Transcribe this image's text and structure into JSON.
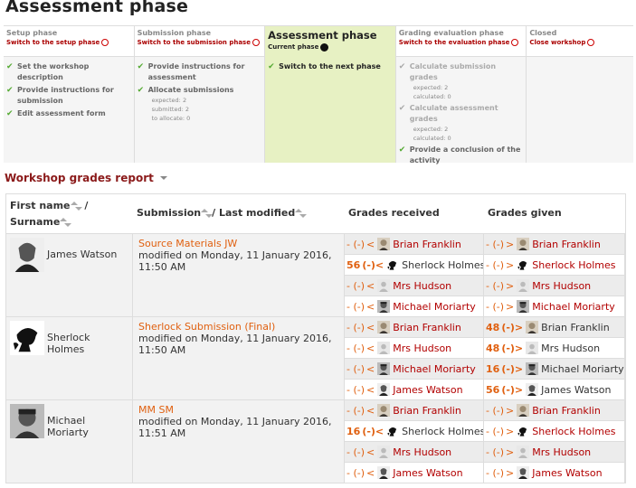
{
  "page_title": "Assessment phase",
  "phases": [
    {
      "name": "Setup phase",
      "action": "Switch to the setup phase",
      "tasks": [
        {
          "label": "Set the workshop description",
          "done": true
        },
        {
          "label": "Provide instructions for submission",
          "done": true
        },
        {
          "label": "Edit assessment form",
          "done": true
        }
      ]
    },
    {
      "name": "Submission phase",
      "action": "Switch to the submission phase",
      "tasks": [
        {
          "label": "Provide instructions for assessment",
          "done": true
        },
        {
          "label": "Allocate submissions",
          "done": true,
          "details": [
            "expected: 2",
            "submitted: 2",
            "to allocate: 0"
          ]
        }
      ]
    },
    {
      "name": "Assessment phase",
      "action": "Current phase",
      "tasks": [
        {
          "label": "Switch to the next phase",
          "done": true
        }
      ]
    },
    {
      "name": "Grading evaluation phase",
      "action": "Switch to the evaluation phase",
      "tasks": [
        {
          "label": "Calculate submission grades",
          "done": false,
          "details": [
            "expected: 2",
            "calculated: 0"
          ]
        },
        {
          "label": "Calculate assessment grades",
          "done": false,
          "details": [
            "expected: 2",
            "calculated: 0"
          ]
        },
        {
          "label": "Provide a conclusion of the activity",
          "done": true
        }
      ]
    },
    {
      "name": "Closed",
      "action": "Close workshop",
      "tasks": []
    }
  ],
  "report": {
    "title": "Workshop grades report",
    "headers": {
      "first_name": "First name",
      "slash": "/",
      "surname": "Surname",
      "submission": "Submission",
      "last_modified": "/ Last modified",
      "received": "Grades received",
      "given": "Grades given"
    },
    "rows": [
      {
        "author": "James Watson",
        "avatar": "watson-portrait-icon",
        "title": "Source Materials JW",
        "modified": "modified on Monday, 11 January 2016, 11:50 AM",
        "received": [
          {
            "grade": "- (-)",
            "sep": "<",
            "name": "Brian Franklin",
            "avatar": "franklin-avatar-icon",
            "bold": false,
            "link": true
          },
          {
            "grade": "56",
            "sep": "(-)<",
            "name": "Sherlock Holmes",
            "avatar": "holmes-silhouette-icon",
            "bold": true,
            "link": false
          },
          {
            "grade": "- (-)",
            "sep": "<",
            "name": "Mrs Hudson",
            "avatar": "blank-avatar-icon",
            "bold": false,
            "link": true
          },
          {
            "grade": "- (-)",
            "sep": "<",
            "name": "Michael Moriarty",
            "avatar": "moriarty-avatar-icon",
            "bold": false,
            "link": true
          }
        ],
        "given": [
          {
            "grade": "- (-)",
            "sep": ">",
            "name": "Brian Franklin",
            "avatar": "franklin-avatar-icon",
            "bold": false,
            "link": true
          },
          {
            "grade": "- (-)",
            "sep": ">",
            "name": "Sherlock Holmes",
            "avatar": "holmes-silhouette-icon",
            "bold": false,
            "link": true
          },
          {
            "grade": "- (-)",
            "sep": ">",
            "name": "Mrs Hudson",
            "avatar": "blank-avatar-icon",
            "bold": false,
            "link": true
          },
          {
            "grade": "- (-)",
            "sep": ">",
            "name": "Michael Moriarty",
            "avatar": "moriarty-avatar-icon",
            "bold": false,
            "link": true
          }
        ]
      },
      {
        "author": "Sherlock Holmes",
        "avatar": "holmes-silhouette-icon",
        "title": "Sherlock Submission (Final)",
        "modified": "modified on Monday, 11 January 2016, 11:50 AM",
        "received": [
          {
            "grade": "- (-)",
            "sep": "<",
            "name": "Brian Franklin",
            "avatar": "franklin-avatar-icon",
            "bold": false,
            "link": true
          },
          {
            "grade": "- (-)",
            "sep": "<",
            "name": "Mrs Hudson",
            "avatar": "blank-avatar-icon",
            "bold": false,
            "link": true
          },
          {
            "grade": "- (-)",
            "sep": "<",
            "name": "Michael Moriarty",
            "avatar": "moriarty-avatar-icon",
            "bold": false,
            "link": true
          },
          {
            "grade": "- (-)",
            "sep": "<",
            "name": "James Watson",
            "avatar": "watson-avatar-icon",
            "bold": false,
            "link": true
          }
        ],
        "given": [
          {
            "grade": "48",
            "sep": "(-)>",
            "name": "Brian Franklin",
            "avatar": "franklin-avatar-icon",
            "bold": true,
            "link": false
          },
          {
            "grade": "48",
            "sep": "(-)>",
            "name": "Mrs Hudson",
            "avatar": "blank-avatar-icon",
            "bold": true,
            "link": false
          },
          {
            "grade": "16",
            "sep": "(-)>",
            "name": "Michael Moriarty",
            "avatar": "moriarty-avatar-icon",
            "bold": true,
            "link": false
          },
          {
            "grade": "56",
            "sep": "(-)>",
            "name": "James Watson",
            "avatar": "watson-avatar-icon",
            "bold": true,
            "link": false
          }
        ]
      },
      {
        "author": "Michael Moriarty",
        "avatar": "moriarty-portrait-icon",
        "title": "MM SM",
        "modified": "modified on Monday, 11 January 2016, 11:51 AM",
        "received": [
          {
            "grade": "- (-)",
            "sep": "<",
            "name": "Brian Franklin",
            "avatar": "franklin-avatar-icon",
            "bold": false,
            "link": true
          },
          {
            "grade": "16",
            "sep": "(-)<",
            "name": "Sherlock Holmes",
            "avatar": "holmes-silhouette-icon",
            "bold": true,
            "link": false
          },
          {
            "grade": "- (-)",
            "sep": "<",
            "name": "Mrs Hudson",
            "avatar": "blank-avatar-icon",
            "bold": false,
            "link": true
          },
          {
            "grade": "- (-)",
            "sep": "<",
            "name": "James Watson",
            "avatar": "watson-avatar-icon",
            "bold": false,
            "link": true
          }
        ],
        "given": [
          {
            "grade": "- (-)",
            "sep": ">",
            "name": "Brian Franklin",
            "avatar": "franklin-avatar-icon",
            "bold": false,
            "link": true
          },
          {
            "grade": "- (-)",
            "sep": ">",
            "name": "Sherlock Holmes",
            "avatar": "holmes-silhouette-icon",
            "bold": false,
            "link": true
          },
          {
            "grade": "- (-)",
            "sep": ">",
            "name": "Mrs Hudson",
            "avatar": "blank-avatar-icon",
            "bold": false,
            "link": true
          },
          {
            "grade": "- (-)",
            "sep": ">",
            "name": "James Watson",
            "avatar": "watson-avatar-icon",
            "bold": false,
            "link": true
          }
        ]
      }
    ]
  },
  "colors": {
    "accent_red": "#b20000",
    "grade_orange": "#e06010",
    "current_phase_bg": "#e7f1c3",
    "check_green": "#55aa33"
  }
}
